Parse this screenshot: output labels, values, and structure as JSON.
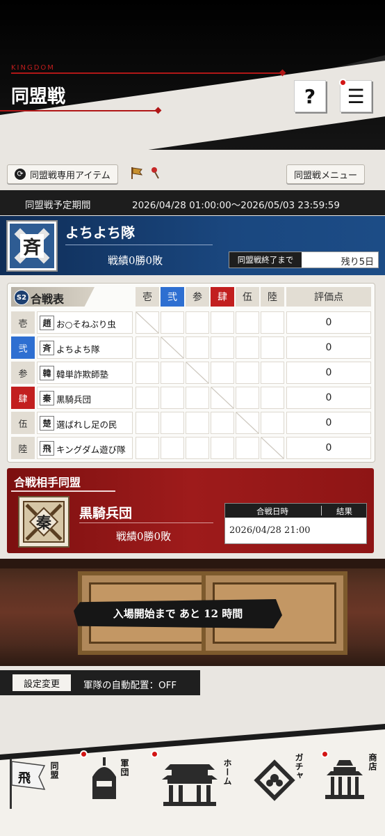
{
  "header": {
    "brand": "KINGDOM",
    "title": "同盟戦",
    "help_label": "?",
    "menu_label": "☰"
  },
  "toolbar": {
    "item_button_label": "同盟戦専用アイテム",
    "menu_button_label": "同盟戦メニュー"
  },
  "period": {
    "label": "同盟戦予定期間",
    "value": "2026/04/28 01:00:00～2026/05/03 23:59:59"
  },
  "alliance": {
    "emblem_char": "斉",
    "name": "よちよち隊",
    "record": "戦績0勝0敗",
    "remaining_label": "同盟戦終了まで",
    "remaining_value": "残り5日"
  },
  "battle_table": {
    "season_badge": "S2",
    "title": "合戦表",
    "columns": [
      "壱",
      "弐",
      "参",
      "肆",
      "伍",
      "陸"
    ],
    "score_header": "評価点",
    "rows": [
      {
        "label": "壱",
        "emblem": "趙",
        "name": "お○そねぶり虫",
        "score": "0"
      },
      {
        "label": "弐",
        "emblem": "斉",
        "name": "よちよち隊",
        "score": "0"
      },
      {
        "label": "参",
        "emblem": "韓",
        "name": "韓単詐欺師塾",
        "score": "0"
      },
      {
        "label": "肆",
        "emblem": "秦",
        "name": "黒騎兵団",
        "score": "0"
      },
      {
        "label": "伍",
        "emblem": "楚",
        "name": "選ばれし足の民",
        "score": "0"
      },
      {
        "label": "陸",
        "emblem": "飛",
        "name": "キングダム遊び隊",
        "score": "0"
      }
    ]
  },
  "opponent": {
    "section_title": "合戦相手同盟",
    "emblem_char": "秦",
    "name": "黒騎兵団",
    "record": "戦績0勝0敗",
    "date_header": "合戦日時",
    "result_header": "結果",
    "date_value": "2026/04/28 21:00",
    "result_value": ""
  },
  "banner": {
    "text": "入場開始まで あと 12 時間"
  },
  "settings": {
    "button_label": "設定変更",
    "auto_deploy": "軍隊の自動配置：OFF"
  },
  "nav": [
    {
      "label": "同盟",
      "icon": "flag-icon",
      "badge_char": "飛"
    },
    {
      "label": "軍団",
      "icon": "helmet-icon"
    },
    {
      "label": "ホーム",
      "icon": "palace-icon"
    },
    {
      "label": "ガチャ",
      "icon": "gacha-icon"
    },
    {
      "label": "商店",
      "icon": "shop-icon"
    }
  ],
  "colors": {
    "accent_red": "#b11717",
    "navy": "#1a477f",
    "blue_col": "#2e6fd1",
    "red_col": "#c21f1f"
  }
}
